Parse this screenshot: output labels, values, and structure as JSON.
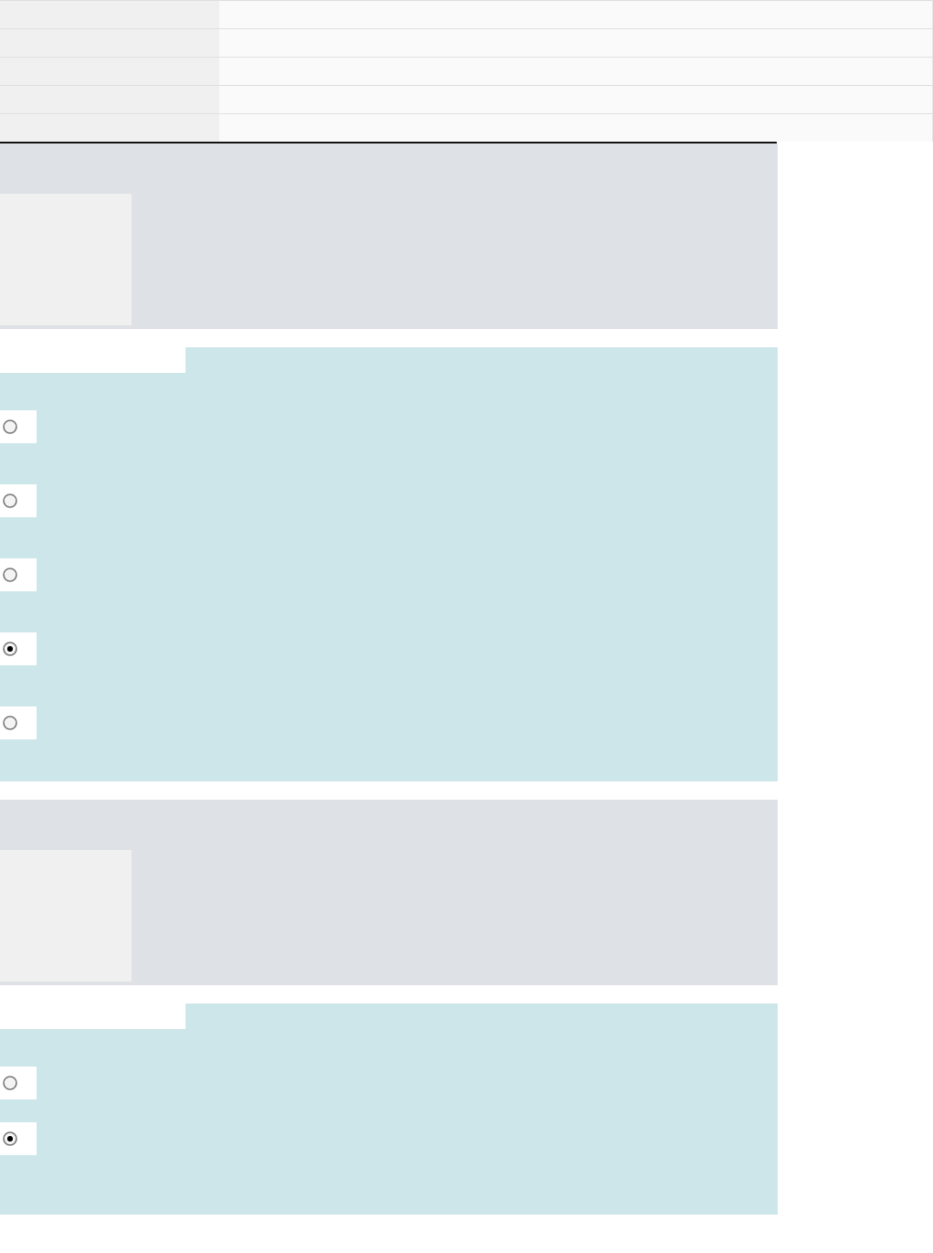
{
  "table": {
    "rows": [
      {
        "kind": "row"
      },
      {
        "kind": "row"
      },
      {
        "kind": "row"
      },
      {
        "kind": "row"
      },
      {
        "kind": "row"
      }
    ]
  },
  "questions": [
    {
      "options": [
        {
          "selected": false
        },
        {
          "selected": false
        },
        {
          "selected": false
        },
        {
          "selected": true
        },
        {
          "selected": false
        }
      ]
    },
    {
      "options": [
        {
          "selected": false
        },
        {
          "selected": true
        }
      ]
    }
  ]
}
